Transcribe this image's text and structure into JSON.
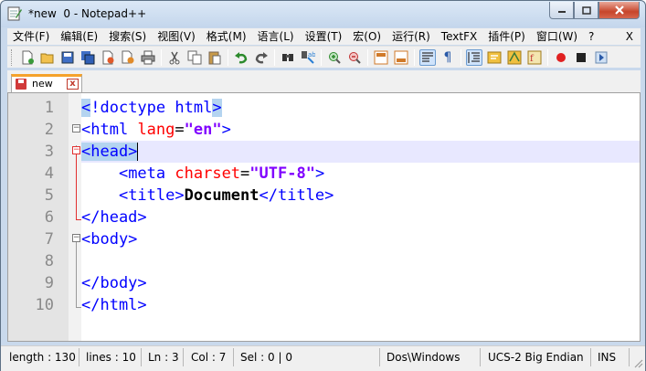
{
  "window": {
    "title": "*new  0 - Notepad++",
    "controls": {
      "minimize": "minimize",
      "maximize": "maximize",
      "close": "close"
    }
  },
  "menu": {
    "items": [
      "文件(F)",
      "编辑(E)",
      "搜索(S)",
      "视图(V)",
      "格式(M)",
      "语言(L)",
      "设置(T)",
      "宏(O)",
      "运行(R)",
      "TextFX",
      "插件(P)",
      "窗口(W)",
      "?"
    ],
    "close_label": "X"
  },
  "toolbar": {
    "icons": [
      "new-file",
      "open-file",
      "save",
      "save-all",
      "close",
      "close-all",
      "print",
      "cut",
      "copy",
      "paste",
      "undo",
      "redo",
      "find",
      "replace",
      "zoom-in",
      "zoom-out",
      "sync-vertical",
      "sync-horizontal",
      "word-wrap",
      "show-all-chars",
      "indent-guide",
      "user-defined-lang",
      "document-map",
      "function-list",
      "record-macro",
      "stop-recording",
      "play-macro"
    ]
  },
  "tab": {
    "label": "new",
    "close": "x"
  },
  "editor": {
    "line_numbers": [
      "1",
      "2",
      "3",
      "4",
      "5",
      "6",
      "7",
      "8",
      "9",
      "10"
    ],
    "current_line": 3
  },
  "status": {
    "length": "length : 130",
    "lines": "lines : 10",
    "ln": "Ln : 3",
    "col": "Col : 7",
    "sel": "Sel : 0 | 0",
    "eol": "Dos\\Windows",
    "encoding": "UCS-2 Big Endian",
    "mode": "INS"
  },
  "colors": {
    "tag": "#0000ff",
    "attribute": "#ff0000",
    "value": "#8000ff",
    "current_line": "#e8e8ff",
    "tab_accent": "#f5a22b"
  }
}
